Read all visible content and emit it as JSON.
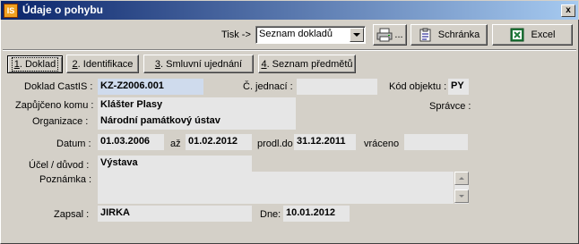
{
  "window": {
    "app_icon_text": "IS",
    "title": "Údaje o pohybu",
    "close": "x"
  },
  "toolbar": {
    "tisk_label": "Tisk ->",
    "tisk_value": "Seznam dokladů",
    "print_button_label": "...",
    "clipboard_button_label": "Schránka",
    "excel_button_label": "Excel"
  },
  "tabs": [
    {
      "key": "1",
      "label": ". Doklad"
    },
    {
      "key": "2",
      "label": ". Identifikace"
    },
    {
      "key": "3",
      "label": ". Smluvní ujednání"
    },
    {
      "key": "4",
      "label": ". Seznam předmětů"
    }
  ],
  "form": {
    "doklad_label": "Doklad CastIS :",
    "doklad_value": "KZ-Z2006.001",
    "cislo_jednaci_label": "Č. jednací :",
    "cislo_jednaci_value": "",
    "kod_objektu_label": "Kód objektu :",
    "kod_objektu_value": "PY",
    "zapujceno_label": "Zapůjčeno komu :",
    "zapujceno_value": "Klášter Plasy",
    "spravce_label": "Správce :",
    "organizace_label": "Organizace :",
    "organizace_value": "Národní památkový ústav",
    "datum_label": "Datum :",
    "datum_value": "01.03.2006",
    "az_label": "až",
    "az_value": "01.02.2012",
    "prodl_label": "prodl.do",
    "prodl_value": "31.12.2011",
    "vraceno_label": "vráceno",
    "vraceno_value": "",
    "ucel_label": "Účel / důvod :",
    "ucel_value": "Výstava",
    "poznamka_label": "Poznámka :",
    "poznamka_value": "",
    "zapsal_label": "Zapsal :",
    "zapsal_value": "JIRKA",
    "dne_label": "Dne:",
    "dne_value": "10.01.2012"
  }
}
